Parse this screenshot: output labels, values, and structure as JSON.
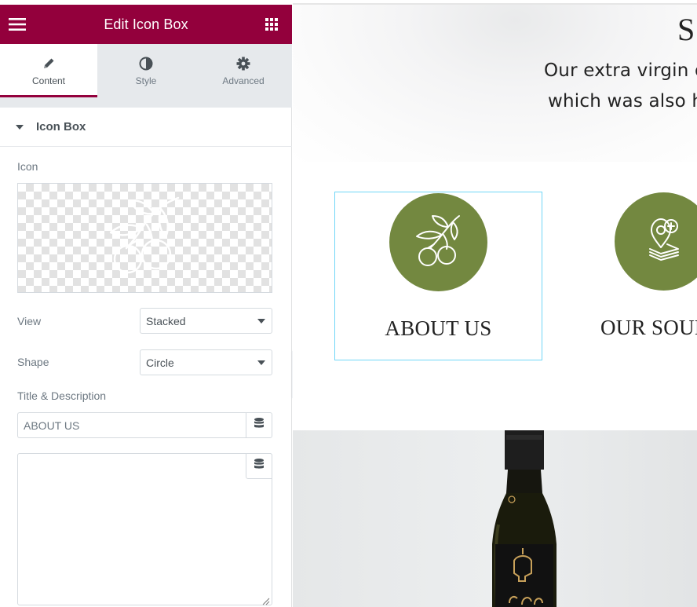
{
  "panel": {
    "title": "Edit Icon Box",
    "menu_icon": "hamburger-icon",
    "apps_icon": "grid-icon",
    "brand_color": "#93003c",
    "tabs": [
      {
        "label": "Content",
        "icon": "pencil-icon",
        "active": true
      },
      {
        "label": "Style",
        "icon": "half-circle-icon",
        "active": false
      },
      {
        "label": "Advanced",
        "icon": "gear-icon",
        "active": false
      }
    ],
    "section": {
      "title": "Icon Box",
      "expanded": true
    },
    "icon_control": {
      "label": "Icon",
      "icon": "olive-branch-icon"
    },
    "view_control": {
      "label": "View",
      "value": "Stacked"
    },
    "shape_control": {
      "label": "Shape",
      "value": "Circle"
    },
    "title_desc": {
      "label": "Title & Description",
      "title_value": "ABOUT US",
      "description_value": "",
      "dynamic_icon": "database-icon"
    },
    "collapse_icon": "chevron-left-icon"
  },
  "preview": {
    "hero_title": "S",
    "hero_line_1": "Our extra virgin o",
    "hero_line_2": "which was also h",
    "accent_color": "#738840",
    "boxes": [
      {
        "title": "ABOUT US",
        "icon": "olive-branch-icon",
        "selected": true
      },
      {
        "title": "OUR SOUR",
        "icon": "location-pin-leaf-icon",
        "selected": false
      }
    ],
    "photo": "olive-oil-bottle-photo"
  }
}
